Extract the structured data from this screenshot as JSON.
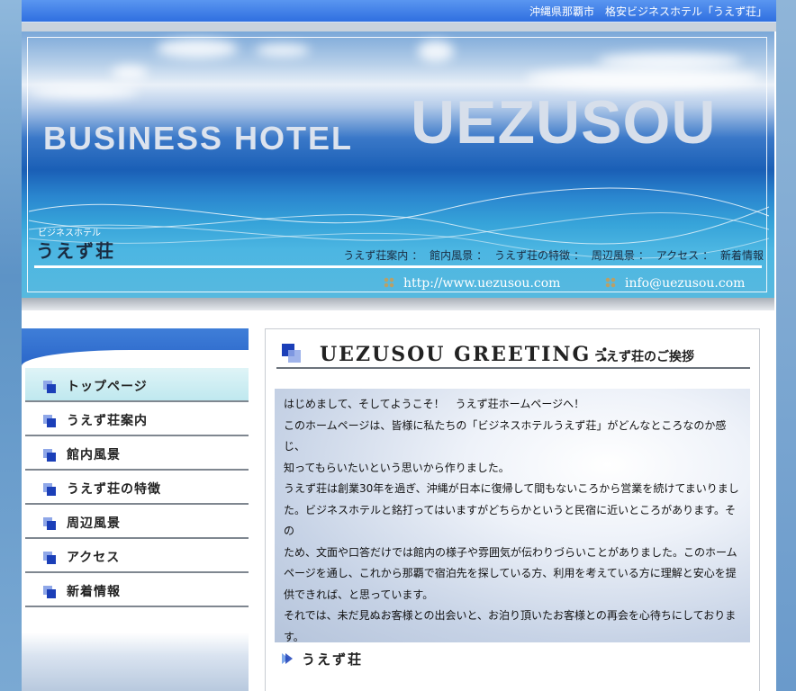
{
  "topbar": {
    "text": "沖縄県那覇市　格安ビジネスホテル「うえず荘」"
  },
  "banner": {
    "title_en_1": "BUSINESS HOTEL",
    "title_en_2": "UEZUSOU",
    "title_jp_small": "ビジネスホテル",
    "title_jp": "うえず荘",
    "nav": [
      "うえず荘案内",
      "館内風景",
      "うえず荘の特徴",
      "周辺風景",
      "アクセス",
      "新着情報"
    ],
    "nav_separator": "：",
    "url": "http://www.uezusou.com",
    "email": "info@uezusou.com"
  },
  "sidebar": {
    "items": [
      {
        "label": "トップページ",
        "active": true
      },
      {
        "label": "うえず荘案内",
        "active": false
      },
      {
        "label": "館内風景",
        "active": false
      },
      {
        "label": "うえず荘の特徴",
        "active": false
      },
      {
        "label": "周辺風景",
        "active": false
      },
      {
        "label": "アクセス",
        "active": false
      },
      {
        "label": "新着情報",
        "active": false
      }
    ]
  },
  "main": {
    "greeting_title_en": "UEZUSOU GREETING ：",
    "greeting_title_jp": "うえず荘のご挨拶",
    "paragraph1": [
      "はじめまして、そしてようこそ！　うえず荘ホームページへ！",
      "このホームページは、皆様に私たちの「ビジネスホテルうえず荘」がどんなところなのか感じ、",
      "知ってもらいたいという思いから作りました。"
    ],
    "paragraph2": [
      "うえず荘は創業30年を過ぎ、沖縄が日本に復帰して間もないころから営業を続けてまいりまし",
      "た。ビジネスホテルと銘打ってはいますがどちらかというと民宿に近いところがあります。その",
      "ため、文面や口答だけでは館内の様子や雰囲気が伝わりづらいことがありました。このホーム",
      "ページを通し、これから那覇で宿泊先を探している方、利用を考えている方に理解と安心を提",
      "供できれば、と思っています。",
      "それでは、未だ見ぬお客様との出会いと、お泊り頂いたお客様との再会を心待ちにしておりま",
      "す。"
    ],
    "section_title": "うえず荘"
  },
  "colors": {
    "topbar": "#3a7ae6",
    "nav_active_bg": "#c9eef3",
    "accent_square": "#1b3fb8"
  }
}
